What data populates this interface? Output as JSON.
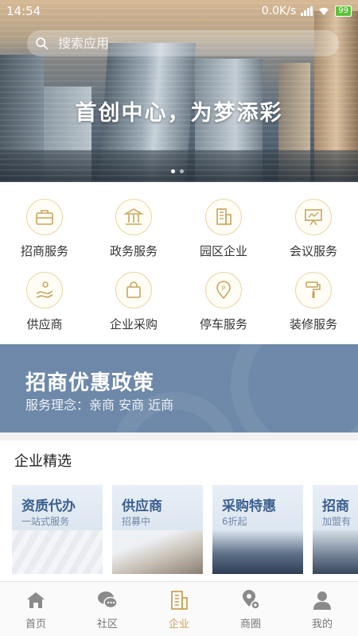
{
  "status_bar": {
    "time": "14:54",
    "speed": "0.0K/s",
    "battery": "99"
  },
  "search": {
    "placeholder": "搜索应用"
  },
  "hero": {
    "slogan": "首创中心，为梦添彩"
  },
  "services": [
    {
      "label": "招商服务",
      "icon": "briefcase-icon"
    },
    {
      "label": "政务服务",
      "icon": "government-building-icon"
    },
    {
      "label": "园区企业",
      "icon": "office-building-icon"
    },
    {
      "label": "会议服务",
      "icon": "presentation-board-icon"
    },
    {
      "label": "供应商",
      "icon": "supplier-hand-icon"
    },
    {
      "label": "企业采购",
      "icon": "shopping-bag-icon"
    },
    {
      "label": "停车服务",
      "icon": "parking-pin-icon"
    },
    {
      "label": "装修服务",
      "icon": "paint-roller-icon"
    }
  ],
  "banner": {
    "title": "招商优惠政策",
    "subtitle": "服务理念：亲商 安商 近商"
  },
  "featured": {
    "title": "企业精选",
    "cards": [
      {
        "title": "资质代办",
        "subtitle": "一站式服务"
      },
      {
        "title": "供应商",
        "subtitle": "招募中"
      },
      {
        "title": "采购特惠",
        "subtitle": "6折起"
      },
      {
        "title": "招商",
        "subtitle": "加盟有"
      }
    ]
  },
  "tabbar": {
    "items": [
      {
        "label": "首页",
        "icon": "home-icon"
      },
      {
        "label": "社区",
        "icon": "chat-bubbles-icon"
      },
      {
        "label": "企业",
        "icon": "enterprise-building-icon"
      },
      {
        "label": "商圈",
        "icon": "location-pin-icon"
      },
      {
        "label": "我的",
        "icon": "person-icon"
      }
    ],
    "active": "企业"
  },
  "colors": {
    "accent": "#c8a55a",
    "banner": "#6d88a8",
    "card_title": "#3a5f8e"
  }
}
